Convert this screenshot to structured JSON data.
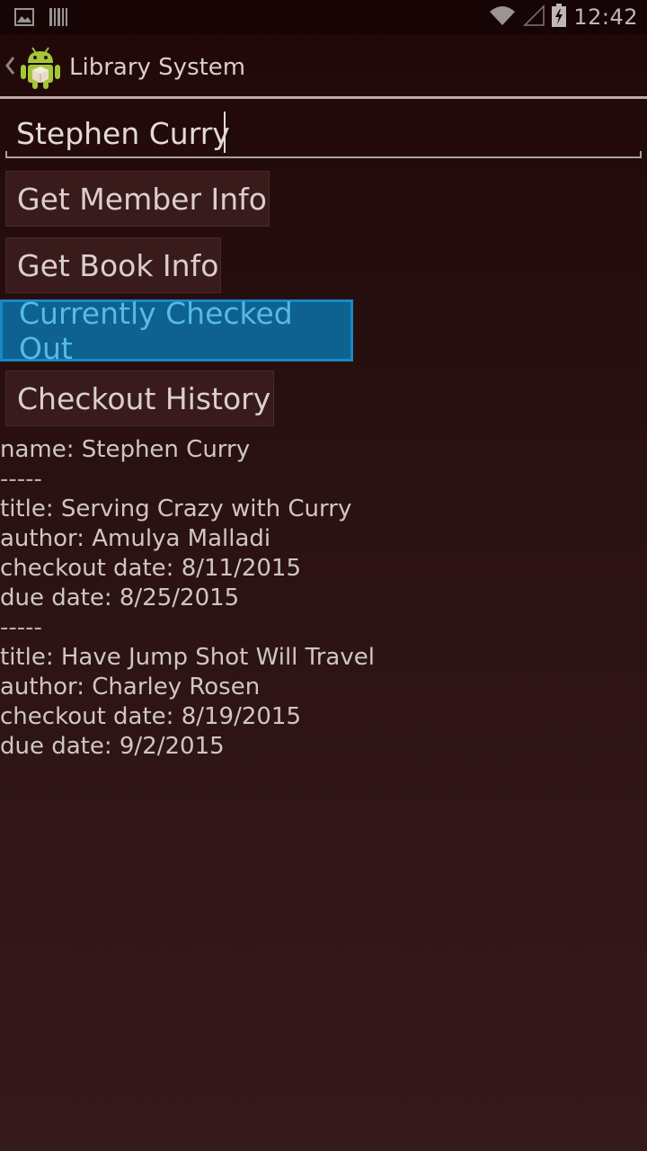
{
  "status_bar": {
    "time": "12:42",
    "left_icons": [
      "image-notification-icon",
      "barcode-notification-icon"
    ],
    "right_icons": [
      "wifi-icon",
      "signal-icon",
      "battery-charging-icon"
    ]
  },
  "action_bar": {
    "title": "Library System",
    "icons": [
      "back-chevron-icon",
      "android-app-icon"
    ]
  },
  "search": {
    "value": "Stephen Curry",
    "placeholder": ""
  },
  "buttons": {
    "member_info": "Get Member Info",
    "book_info": "Get Book Info",
    "checked_out": "Currently Checked Out",
    "history": "Checkout History"
  },
  "active_button": "checked_out",
  "result": {
    "member_line": "name: Stephen Curry",
    "separator": "-----",
    "books": [
      {
        "title": "title: Serving Crazy with Curry",
        "author": "author: Amulya Malladi",
        "checkout": "checkout date: 8/11/2015",
        "due": "due date: 8/25/2015"
      },
      {
        "title": "title: Have Jump Shot Will Travel",
        "author": "author: Charley Rosen",
        "checkout": "checkout date: 8/19/2015",
        "due": "due date: 9/2/2015"
      }
    ]
  },
  "colors": {
    "active_button_bg": "#0e628f",
    "active_button_text": "#56b9ea",
    "background_top": "#200808",
    "background_bottom": "#351a1b"
  }
}
